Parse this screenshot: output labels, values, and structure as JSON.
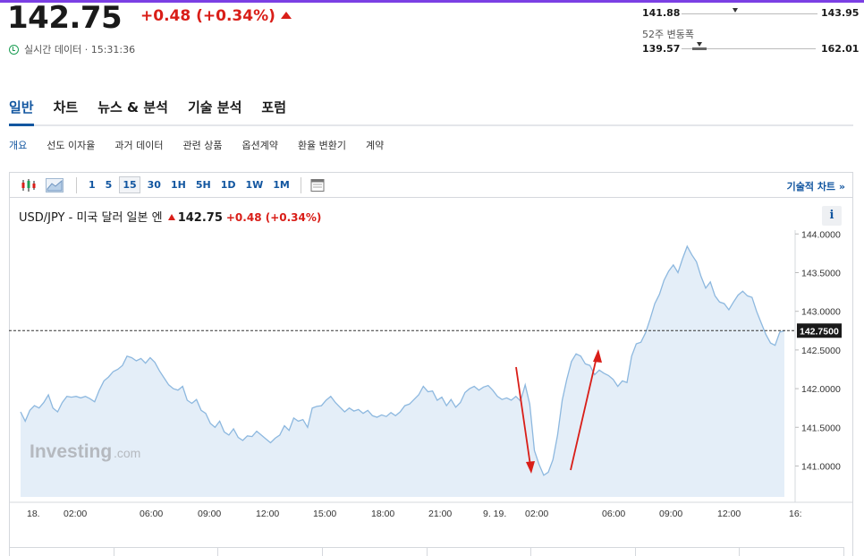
{
  "quote": {
    "price": "142.75",
    "change": "+0.48 (+0.34%)",
    "realtime_label": "실시간 데이터 · 15:31:36"
  },
  "day_range": {
    "low": "141.88",
    "high": "143.95",
    "marker_fraction": 0.47
  },
  "week52_range": {
    "label": "52주 변동폭",
    "low": "139.57",
    "high": "162.01",
    "marker_fraction": 0.142
  },
  "tabs": [
    "일반",
    "차트",
    "뉴스 & 분석",
    "기술 분석",
    "포럼"
  ],
  "subtabs": [
    "개요",
    "선도 이자율",
    "과거 데이터",
    "관련 상품",
    "옵션계약",
    "환율 변환기",
    "계약"
  ],
  "toolbar": {
    "intervals": [
      "1",
      "5",
      "15",
      "30",
      "1H",
      "5H",
      "1D",
      "1W",
      "1M"
    ],
    "active_interval": "15",
    "tech_chart_link": "기술적 차트 »"
  },
  "chart_header": {
    "pair": "USD/JPY - 미국 달러 일본 엔",
    "price": "142.75",
    "change": "+0.48 (+0.34%)",
    "info": "i"
  },
  "watermark": {
    "brand": "Investing",
    "suffix": ".com"
  },
  "colors": {
    "accent": "#1256a0",
    "down_red": "#d91e18",
    "line": "#8db8df",
    "fill": "#e4eef8"
  },
  "chart_data": {
    "type": "area",
    "title": "",
    "x_tick_labels": [
      "18.",
      "02:00",
      "06:00",
      "09:00",
      "12:00",
      "15:00",
      "18:00",
      "21:00",
      "9. 19.",
      "02:00",
      "06:00",
      "09:00",
      "12:00",
      "16:"
    ],
    "y_tick_labels": [
      "144.0000",
      "143.5000",
      "143.0000",
      "142.5000",
      "142.0000",
      "141.5000",
      "141.0000"
    ],
    "ylim": [
      140.6,
      144.05
    ],
    "current_value": 142.75,
    "current_label": "142.7500",
    "values": [
      141.7,
      141.58,
      141.72,
      141.78,
      141.75,
      141.82,
      141.92,
      141.75,
      141.7,
      141.82,
      141.9,
      141.89,
      141.9,
      141.88,
      141.9,
      141.87,
      141.83,
      141.98,
      142.1,
      142.15,
      142.22,
      142.25,
      142.3,
      142.42,
      142.4,
      142.36,
      142.39,
      142.33,
      142.4,
      142.34,
      142.23,
      142.14,
      142.05,
      142.0,
      141.98,
      142.03,
      141.85,
      141.81,
      141.86,
      141.72,
      141.68,
      141.55,
      141.5,
      141.58,
      141.44,
      141.4,
      141.48,
      141.37,
      141.33,
      141.39,
      141.38,
      141.45,
      141.4,
      141.35,
      141.3,
      141.36,
      141.4,
      141.52,
      141.46,
      141.62,
      141.58,
      141.6,
      141.5,
      141.75,
      141.77,
      141.78,
      141.85,
      141.9,
      141.82,
      141.76,
      141.7,
      141.75,
      141.71,
      141.73,
      141.68,
      141.72,
      141.65,
      141.63,
      141.66,
      141.64,
      141.69,
      141.65,
      141.7,
      141.78,
      141.8,
      141.86,
      141.92,
      142.03,
      141.96,
      141.97,
      141.85,
      141.89,
      141.78,
      141.86,
      141.76,
      141.82,
      141.95,
      142.0,
      142.03,
      141.98,
      142.02,
      142.04,
      141.98,
      141.9,
      141.86,
      141.88,
      141.85,
      141.9,
      141.84,
      142.05,
      141.8,
      141.2,
      141.02,
      140.88,
      140.92,
      141.08,
      141.4,
      141.85,
      142.12,
      142.35,
      142.45,
      142.42,
      142.32,
      142.3,
      142.18,
      142.24,
      142.2,
      142.17,
      142.12,
      142.03,
      142.1,
      142.08,
      142.42,
      142.58,
      142.6,
      142.72,
      142.9,
      143.1,
      143.22,
      143.4,
      143.52,
      143.6,
      143.5,
      143.68,
      143.84,
      143.73,
      143.64,
      143.45,
      143.3,
      143.38,
      143.2,
      143.12,
      143.1,
      143.02,
      143.12,
      143.21,
      143.26,
      143.2,
      143.18,
      143.0,
      142.85,
      142.7,
      142.59,
      142.56,
      142.73,
      142.75
    ],
    "grid": false,
    "annotations": [
      "red arrow pointing down",
      "red arrow pointing up"
    ]
  }
}
